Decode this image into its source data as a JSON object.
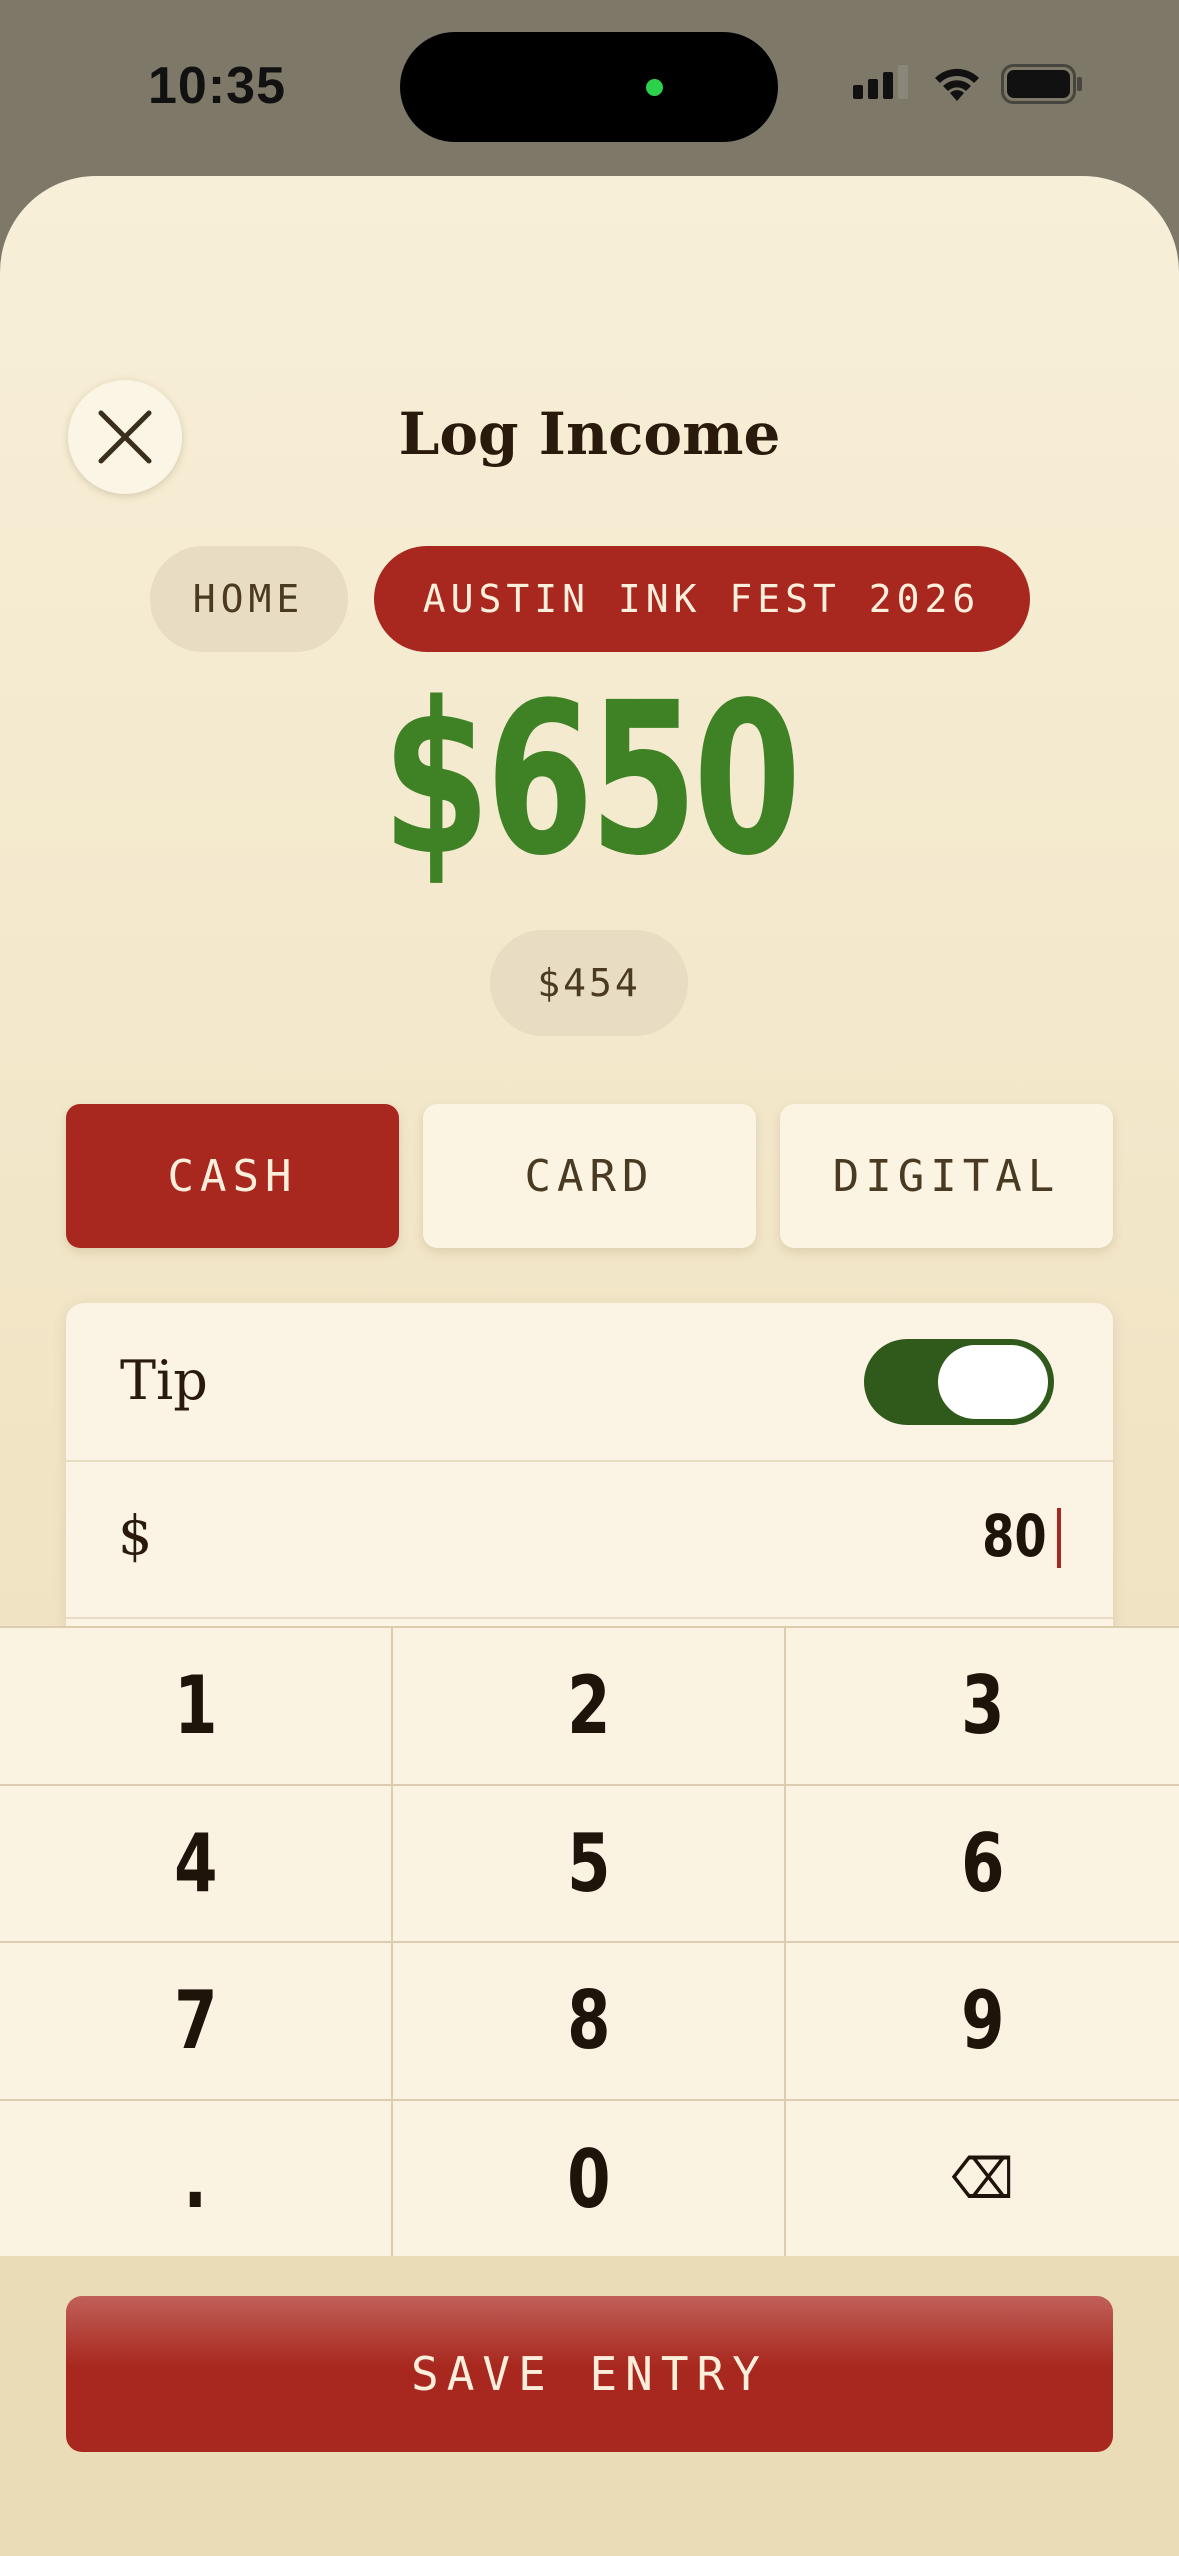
{
  "status_bar": {
    "time": "10:35"
  },
  "header": {
    "title": "Log Income"
  },
  "chips": {
    "home": "HOME",
    "event": "AUSTIN INK FEST 2026"
  },
  "amount": {
    "total": "$650",
    "secondary": "$454"
  },
  "payment_methods": [
    {
      "label": "CASH",
      "selected": true
    },
    {
      "label": "CARD",
      "selected": false
    },
    {
      "label": "DIGITAL",
      "selected": false
    }
  ],
  "tip": {
    "label": "Tip",
    "enabled": true,
    "currency_symbol": "$",
    "value": "80"
  },
  "keypad": {
    "keys": [
      "1",
      "2",
      "3",
      "4",
      "5",
      "6",
      "7",
      "8",
      "9",
      ".",
      "0",
      "⌫"
    ]
  },
  "footer": {
    "save_label": "SAVE ENTRY"
  },
  "colors": {
    "accent": "#a8281f",
    "amount_green": "#3f8226",
    "toggle_on": "#2f5a1c",
    "sheet_bg": "#f4ead0"
  }
}
